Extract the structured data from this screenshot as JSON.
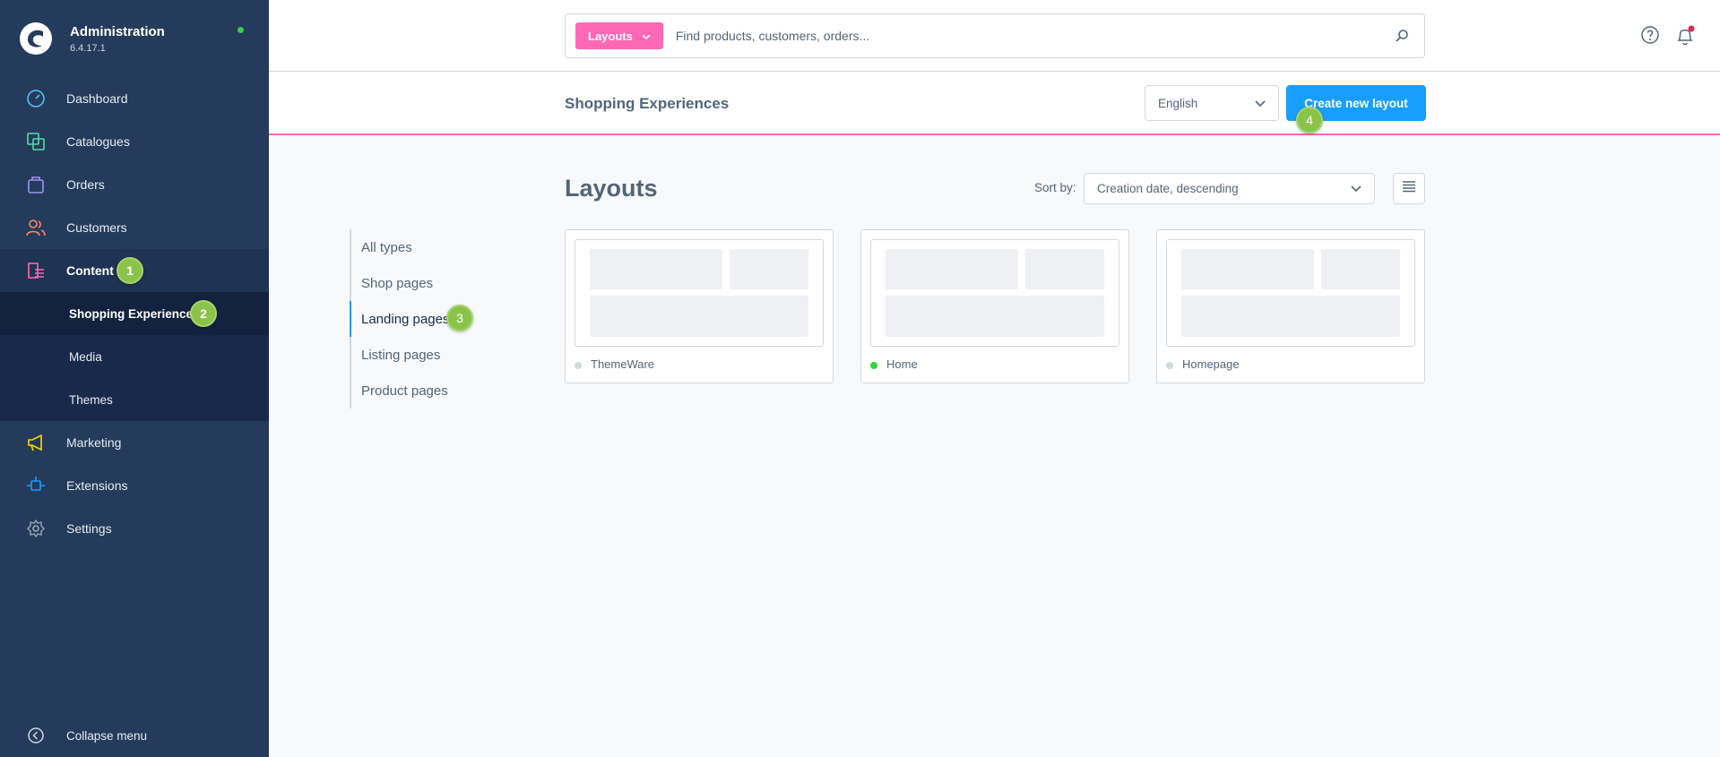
{
  "app": {
    "title": "Administration",
    "version": "6.4.17.1",
    "status_color": "#37d046"
  },
  "sidebar": {
    "items": [
      {
        "label": "Dashboard",
        "icon": "dashboard-icon",
        "color": "#4fc3f7"
      },
      {
        "label": "Catalogues",
        "icon": "catalogues-icon",
        "color": "#57d9a3"
      },
      {
        "label": "Orders",
        "icon": "orders-icon",
        "color": "#a092f0"
      },
      {
        "label": "Customers",
        "icon": "customers-icon",
        "color": "#f88962"
      },
      {
        "label": "Content",
        "icon": "content-icon",
        "color": "#ff68b4"
      },
      {
        "label": "Marketing",
        "icon": "marketing-icon",
        "color": "#ffd700"
      },
      {
        "label": "Extensions",
        "icon": "extensions-icon",
        "color": "#189eff"
      },
      {
        "label": "Settings",
        "icon": "settings-icon",
        "color": "#9aa8b5"
      }
    ],
    "content_sub": [
      {
        "label": "Shopping Experiences"
      },
      {
        "label": "Media"
      },
      {
        "label": "Themes"
      }
    ],
    "collapse_label": "Collapse menu"
  },
  "search": {
    "type_label": "Layouts",
    "placeholder": "Find products, customers, orders..."
  },
  "page": {
    "title": "Shopping Experiences",
    "language": "English",
    "create_label": "Create new layout"
  },
  "layouts": {
    "title": "Layouts",
    "sort_label": "Sort by:",
    "sort_value": "Creation date, descending",
    "types": [
      "All types",
      "Shop pages",
      "Landing pages",
      "Listing pages",
      "Product pages"
    ],
    "cards": [
      {
        "name": "ThemeWare",
        "active": false
      },
      {
        "name": "Home",
        "active": true
      },
      {
        "name": "Homepage",
        "active": false
      }
    ]
  },
  "steps": [
    "1",
    "2",
    "3",
    "4"
  ],
  "colors": {
    "accent": "#189eff",
    "brand_pink": "#ff68b4",
    "sidebar_bg": "#253b5b",
    "step_badge": "#8bc34a",
    "active_dot": "#37d046",
    "inactive_dot": "#d1d9e0"
  }
}
